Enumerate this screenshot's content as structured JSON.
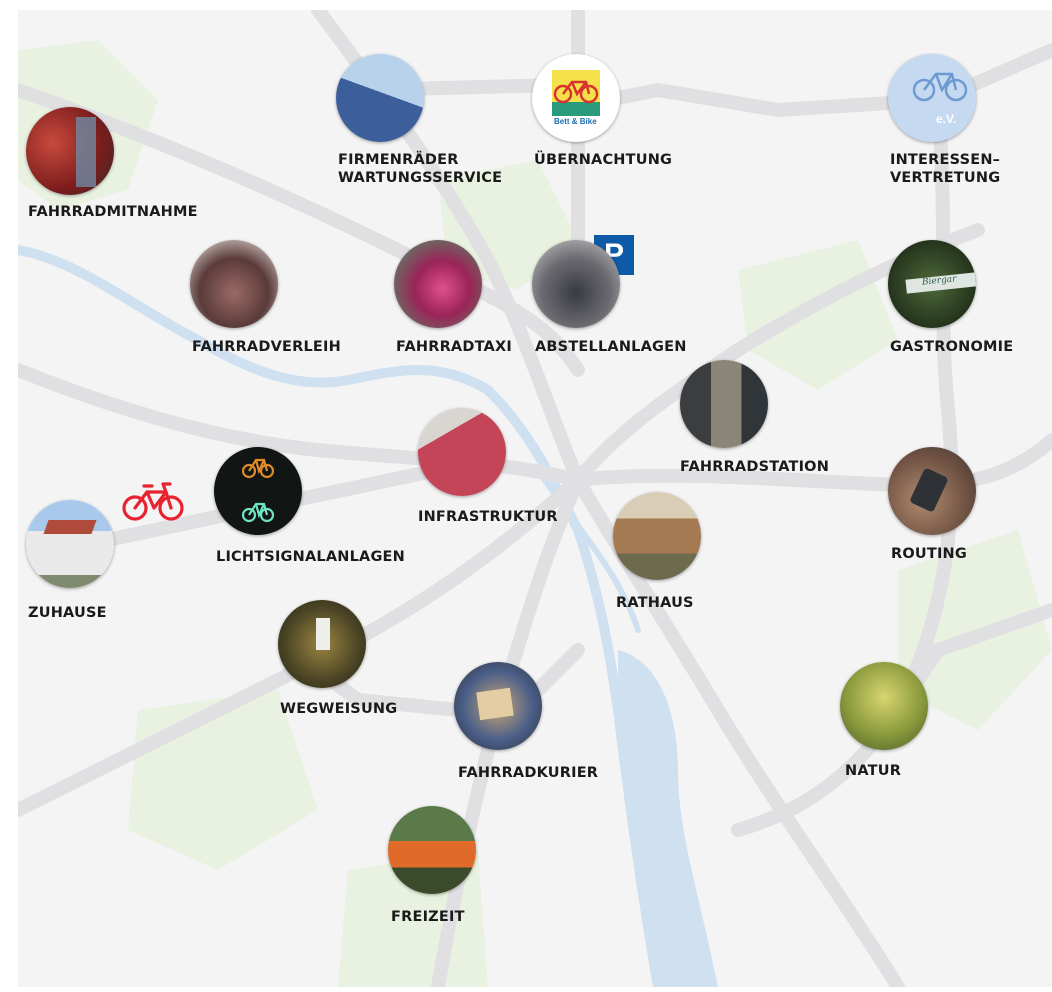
{
  "map": {
    "parking_sign": "P",
    "bett_bike_logo_text": "Bett & Bike",
    "ev_logo_text": "e.V.",
    "tent_sign_text": "Biergar",
    "colors": {
      "background": "#f4f4f5",
      "road": "#e2e2e4",
      "water": "#cfe1f0",
      "green": "#e9f2e1",
      "bike_icon": "#e8222e",
      "parking": "#0e5aa7"
    }
  },
  "pois": [
    {
      "id": "fahrradmitnahme",
      "label": "FAHRRADMITNAHME"
    },
    {
      "id": "firmenraeder",
      "label_lines": [
        "FIRMENRÄDER",
        "WARTUNGSSERVICE"
      ]
    },
    {
      "id": "uebernachtung",
      "label": "ÜBERNACHTUNG"
    },
    {
      "id": "interessenvertretung",
      "label_lines": [
        "INTERESSEN–",
        "VERTRETUNG"
      ]
    },
    {
      "id": "fahrradverleih",
      "label": "FAHRRADVERLEIH"
    },
    {
      "id": "fahrradtaxi",
      "label": "FAHRRADTAXI"
    },
    {
      "id": "abstellanlagen",
      "label": "ABSTELLANLAGEN"
    },
    {
      "id": "gastronomie",
      "label": "GASTRONOMIE"
    },
    {
      "id": "fahrradstation",
      "label": "FAHRRADSTATION"
    },
    {
      "id": "infrastruktur",
      "label": "INFRASTRUKTUR"
    },
    {
      "id": "lichtsignalanlagen",
      "label": "LICHTSIGNALANLAGEN"
    },
    {
      "id": "routing",
      "label": "ROUTING"
    },
    {
      "id": "rathaus",
      "label": "RATHAUS"
    },
    {
      "id": "zuhause",
      "label": "ZUHAUSE"
    },
    {
      "id": "wegweisung",
      "label": "WEGWEISUNG"
    },
    {
      "id": "fahrradkurier",
      "label": "FAHRRADKURIER"
    },
    {
      "id": "natur",
      "label": "NATUR"
    },
    {
      "id": "freizeit",
      "label": "FREIZEIT"
    }
  ]
}
